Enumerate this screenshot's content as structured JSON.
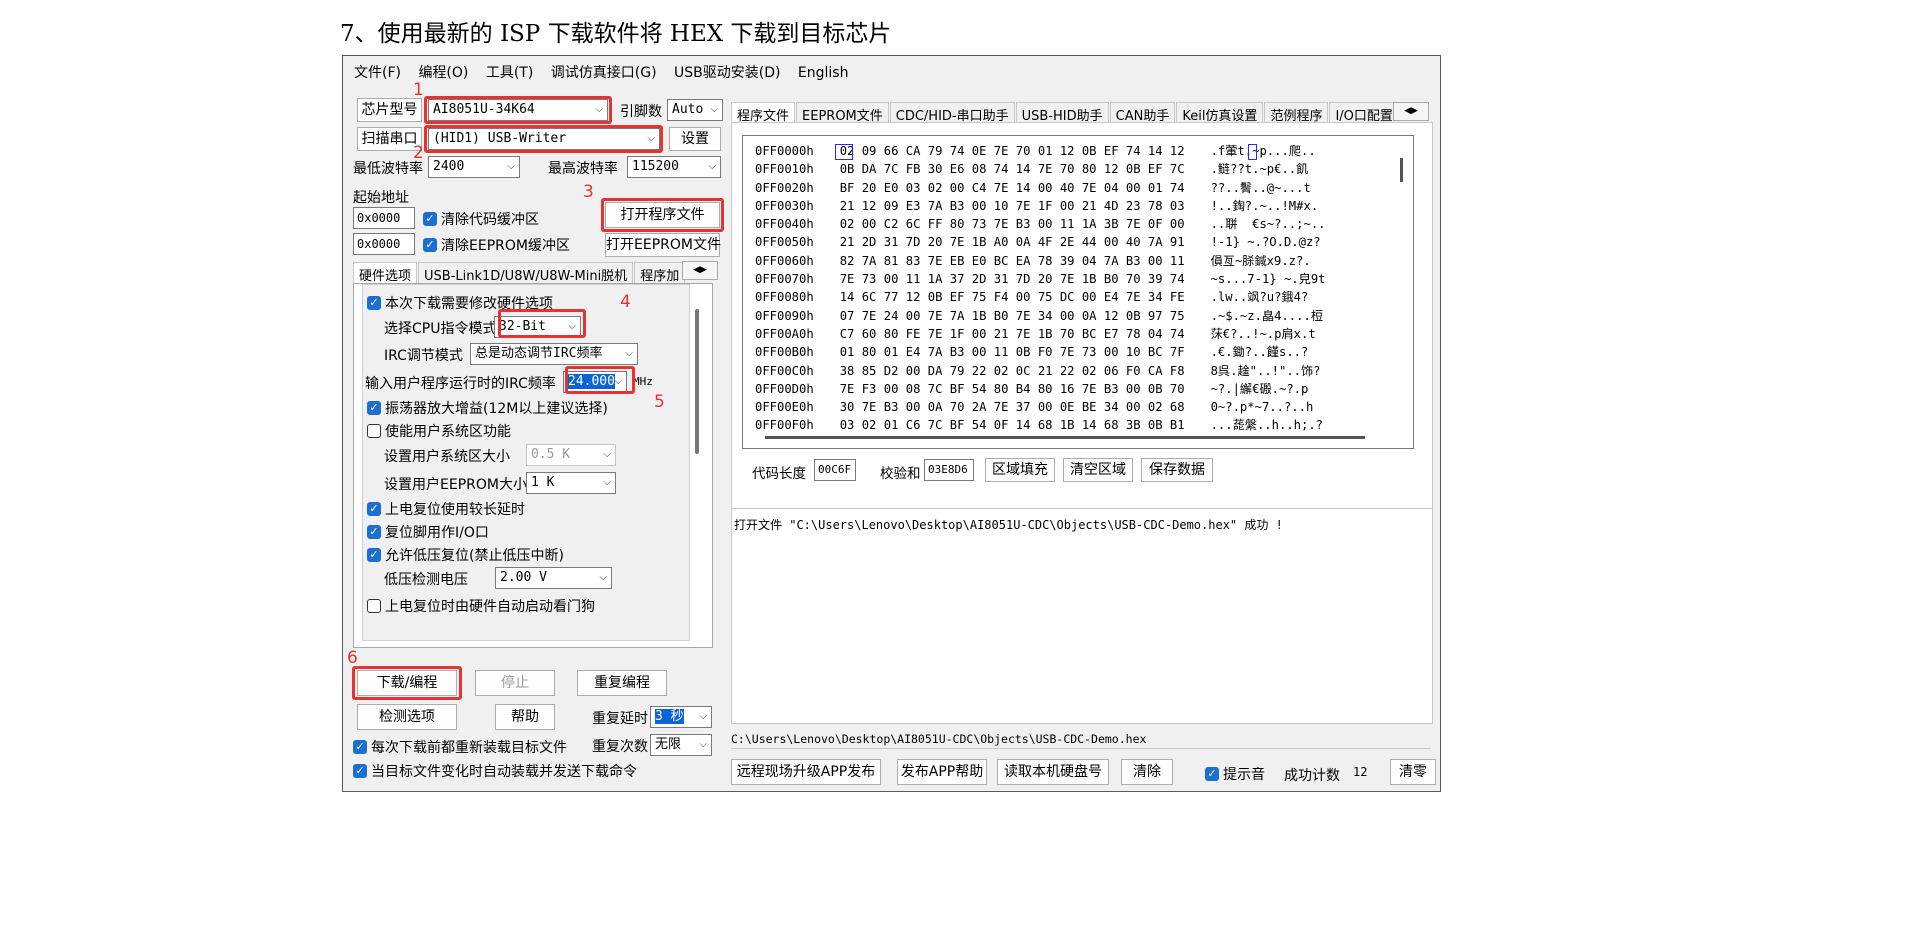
{
  "doc_heading": "7、使用最新的 ISP 下载软件将 HEX 下载到目标芯片",
  "menu": [
    "文件(F)",
    "编程(O)",
    "工具(T)",
    "调试仿真接口(G)",
    "USB驱动安装(D)",
    "English"
  ],
  "left": {
    "chip_label": "芯片型号",
    "chip_value": "AI8051U-34K64",
    "pins_label": "引脚数",
    "pins_value": "Auto",
    "scan_label": "扫描串口",
    "port_value": "(HID1) USB-Writer",
    "settings_button": "设置",
    "min_baud_label": "最低波特率",
    "min_baud_value": "2400",
    "max_baud_label": "最高波特率",
    "max_baud_value": "115200",
    "start_addr_label": "起始地址",
    "addr1": "0x0000",
    "addr2": "0x0000",
    "clear_code_label": "清除代码缓冲区",
    "clear_eeprom_label": "清除EEPROM缓冲区",
    "open_prog_button": "打开程序文件",
    "open_eeprom_button": "打开EEPROM文件",
    "tabs": [
      "硬件选项",
      "USB-Link1D/U8W/U8W-Mini脱机",
      "程序加"
    ],
    "hw": {
      "modify_opts": "本次下载需要修改硬件选项",
      "cpu_mode_label": "选择CPU指令模式",
      "cpu_mode_value": "32-Bit",
      "irc_mode_label": "IRC调节模式",
      "irc_mode_value": "总是动态调节IRC频率",
      "irc_freq_label": "输入用户程序运行时的IRC频率",
      "irc_freq_value": "24.000",
      "irc_freq_unit": "MHz",
      "osc_gain": "振荡器放大增益(12M以上建议选择)",
      "enable_sys_area": "使能用户系统区功能",
      "sys_area_size_label": "设置用户系统区大小",
      "sys_area_size_value": "0.5 K",
      "eeprom_size_label": "设置用户EEPROM大小",
      "eeprom_size_value": "1  K",
      "power_reset_delay": "上电复位使用较长延时",
      "reset_pin_io": "复位脚用作I/O口",
      "allow_lvr": "允许低压复位(禁止低压中断)",
      "lvd_label": "低压检测电压",
      "lvd_value": "2.00 V",
      "watchdog": "上电复位时由硬件自动启动看门狗"
    },
    "download_button": "下载/编程",
    "stop_button": "停止",
    "reprogram_button": "重复编程",
    "check_button": "检测选项",
    "help_button": "帮助",
    "repeat_delay_label": "重复延时",
    "repeat_delay_value": "3 秒",
    "repeat_count_label": "重复次数",
    "repeat_count_value": "无限",
    "reload_each": "每次下载前都重新装载目标文件",
    "auto_reload": "当目标文件变化时自动装载并发送下载命令"
  },
  "annotations": [
    "1",
    "2",
    "3",
    "4",
    "5",
    "6"
  ],
  "right": {
    "tabs": [
      "程序文件",
      "EEPROM文件",
      "CDC/HID-串口助手",
      "USB-HID助手",
      "CAN助手",
      "Keil仿真设置",
      "范例程序",
      "I/O口配置"
    ],
    "hex_rows": [
      {
        "addr": "0FF0000h",
        "bytes": "02 09 66 CA 79 74 0E 7E 70 01 12 0B EF 74 14 12",
        "ascii": ".f葷t.~p...爬.."
      },
      {
        "addr": "0FF0010h",
        "bytes": "0B DA 7C FB 30 E6 08 74 14 7E 70 80 12 0B EF 7C",
        "ascii": ".鲢??t.~p€..飢"
      },
      {
        "addr": "0FF0020h",
        "bytes": "BF 20 E0 03 02 00 C4 7E 14 00 40 7E 04 00 01 74",
        "ascii": "??..鬌..@~...t"
      },
      {
        "addr": "0FF0030h",
        "bytes": "21 12 09 E3 7A B3 00 10 7E 1F 00 21 4D 23 78 03",
        "ascii": "!..鋾?.~..!M#x."
      },
      {
        "addr": "0FF0040h",
        "bytes": "02 00 C2 6C FF 80 73 7E B3 00 11 1A 3B 7E 0F 00",
        "ascii": "..聠  €s~?..;~.."
      },
      {
        "addr": "0FF0050h",
        "bytes": "21 2D 31 7D 20 7E 1B A0 0A 4F 2E 44 00 40 7A 91",
        "ascii": "!-1} ~.?O.D.@z?"
      },
      {
        "addr": "0FF0060h",
        "bytes": "82 7A 81 83 7E EB E0 BC EA 78 39 04 7A B3 00 11",
        "ascii": "傊亙~脎鍼x9.z?."
      },
      {
        "addr": "0FF0070h",
        "bytes": "7E 73 00 11 1A 37 2D 31 7D 20 7E 1B B0 70 39 74",
        "ascii": "~s...7-1} ~.皃9t"
      },
      {
        "addr": "0FF0080h",
        "bytes": "14 6C 77 12 0B EF 75 F4 00 75 DC 00 E4 7E 34 FE",
        "ascii": ".lw..飒?u?鋨4?"
      },
      {
        "addr": "0FF0090h",
        "bytes": "07 7E 24 00 7E 7A 1B B0 7E 34 00 0A 12 0B 97 75",
        "ascii": ".~$.~z.皛4....梪"
      },
      {
        "addr": "0FF00A0h",
        "bytes": "C7 60 80 FE 7E 1F 00 21 7E 1B 70 BC E7 78 04 74",
        "ascii": "莯€?..!~.p肩x.t"
      },
      {
        "addr": "0FF00B0h",
        "bytes": "01 80 01 E4 7A B3 00 11 0B F0 7E 73 00 10 BC 7F",
        "ascii": ".€.鋤?..饉s..?"
      },
      {
        "addr": "0FF00C0h",
        "bytes": "38 85 D2 00 DA 79 22 02 0C 21 22 02 06 F0 CA F8",
        "ascii": "8呉.趛\"..!\"..饰?"
      },
      {
        "addr": "0FF00D0h",
        "bytes": "7E F3 00 08 7C BF 54 80 B4 80 16 7E B3 00 0B 70",
        "ascii": "~?.|繲€磤.~?.p"
      },
      {
        "addr": "0FF00E0h",
        "bytes": "30 7E B3 00 0A 70 2A 7E 37 00 0E BE 34 00 02 68",
        "ascii": "0~?.p*~7..?..h"
      },
      {
        "addr": "0FF00F0h",
        "bytes": "03 02 01 C6 7C BF 54 0F 14 68 1B 14 68 3B 0B B1",
        "ascii": "...蒊縏..h..h;.?"
      }
    ],
    "code_len_label": "代码长度",
    "code_len_value": "00C6F",
    "checksum_label": "校验和",
    "checksum_value": "03E8D6",
    "fill_button": "区域填充",
    "clear_area_button": "清空区域",
    "save_button": "保存数据",
    "log_text": "打开文件 \"C:\\Users\\Lenovo\\Desktop\\AI8051U-CDC\\Objects\\USB-CDC-Demo.hex\" 成功 !",
    "path_text": "C:\\Users\\Lenovo\\Desktop\\AI8051U-CDC\\Objects\\USB-CDC-Demo.hex",
    "remote_upgrade_button": "远程现场升级APP发布",
    "publish_help_button": "发布APP帮助",
    "read_disk_button": "读取本机硬盘号",
    "clear_button": "清除",
    "prompt_sound_label": "提示音",
    "success_count_label": "成功计数",
    "success_count_value": "12",
    "reset_count_button": "清零"
  }
}
